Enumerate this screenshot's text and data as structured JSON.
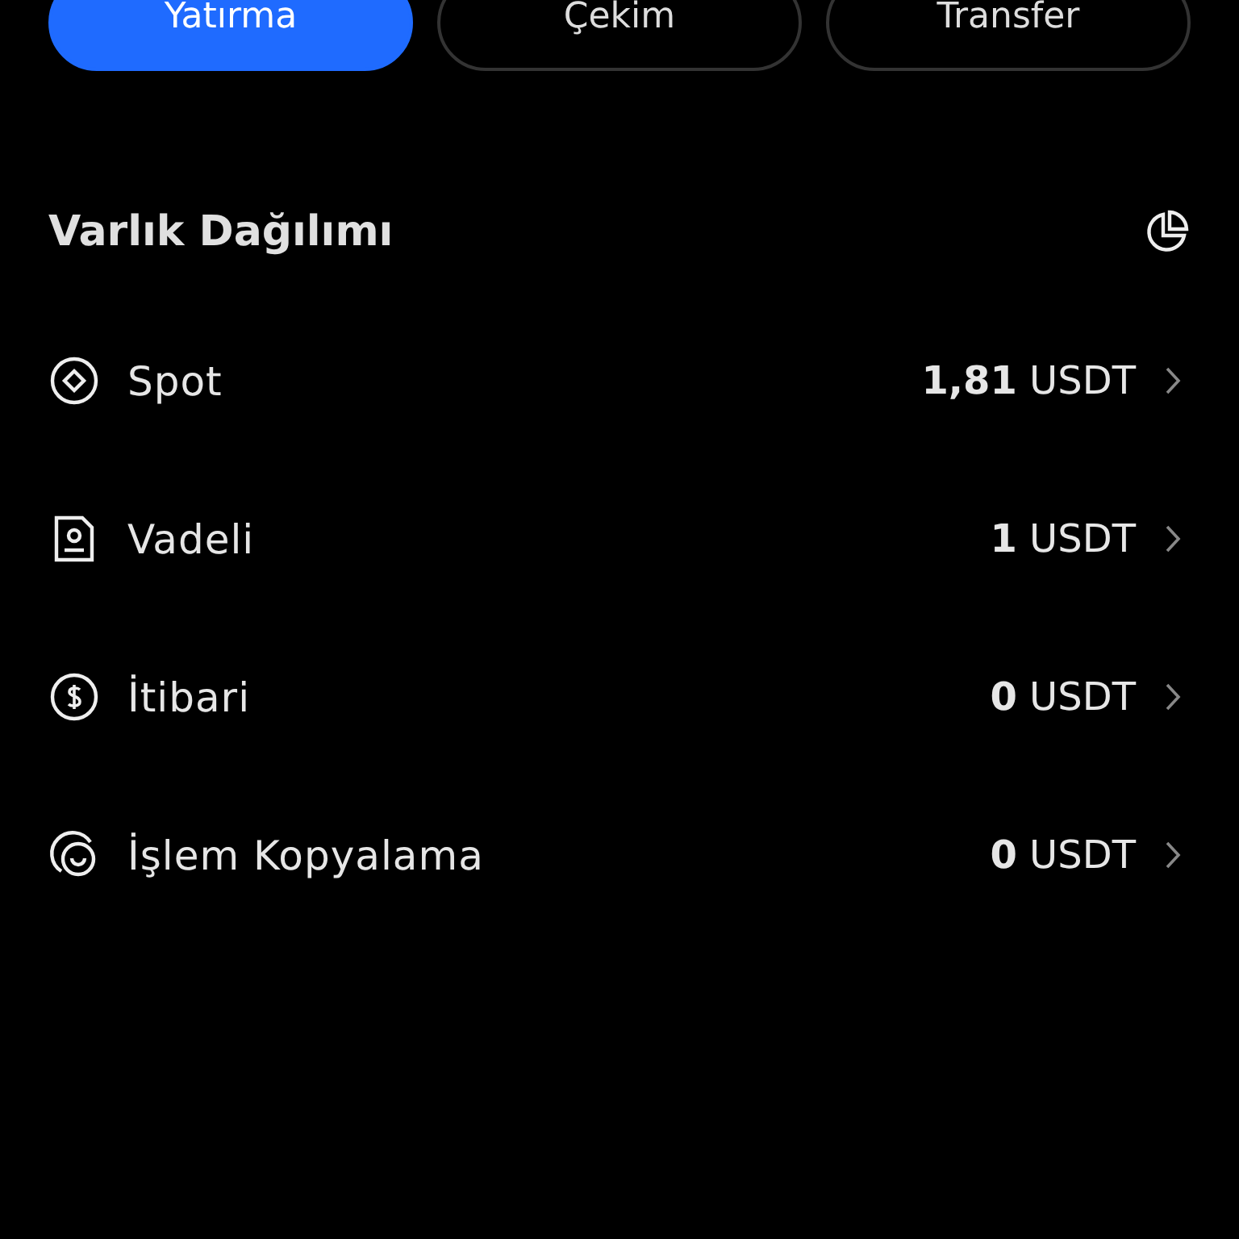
{
  "actions": [
    {
      "label": "Yatırma",
      "selected": true
    },
    {
      "label": "Çekim",
      "selected": false
    },
    {
      "label": "Transfer",
      "selected": false
    }
  ],
  "section": {
    "title": "Varlık Dağılımı"
  },
  "accounts": [
    {
      "name": "Spot",
      "amount": "**1,81** USDT"
    },
    {
      "name": "Vadeli",
      "amount": "**1** USDT"
    },
    {
      "name": "İtibari",
      "amount": "**0** USDT"
    },
    {
      "name": "İşlem Kopyalama",
      "amount": "**0** USDT"
    }
  ]
}
